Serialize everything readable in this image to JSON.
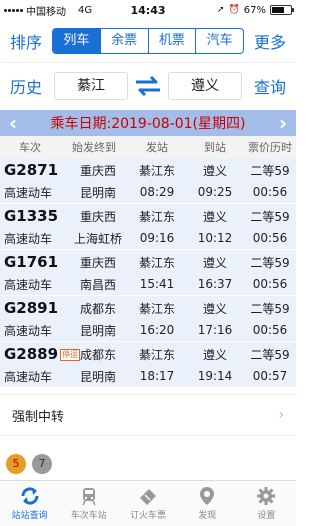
{
  "status": {
    "carrier": "中国移动",
    "network": "4G",
    "time": "14:43",
    "battery_pct": "67%",
    "battery_level": 0.67
  },
  "nav": {
    "left": "排序",
    "right": "更多",
    "segments": [
      {
        "label": "列车",
        "active": true
      },
      {
        "label": "余票",
        "active": false
      },
      {
        "label": "机票",
        "active": false
      },
      {
        "label": "汽车",
        "active": false
      }
    ]
  },
  "search": {
    "history": "历史",
    "from": "綦江",
    "to": "遵义",
    "query": "查询"
  },
  "date": {
    "text": "乘车日期:2019-08-01(星期四)"
  },
  "columns": [
    "车次",
    "始发终到",
    "发站",
    "到站",
    "票价历时"
  ],
  "trains": [
    {
      "no": "G2871",
      "type": "高速动车",
      "origin": "重庆西",
      "terminal": "昆明南",
      "dep_station": "綦江东",
      "dep_time": "08:29",
      "arr_station": "遵义",
      "arr_time": "09:25",
      "seat": "二等59",
      "duration": "00:56",
      "badge": ""
    },
    {
      "no": "G1335",
      "type": "高速动车",
      "origin": "重庆西",
      "terminal": "上海虹桥",
      "dep_station": "綦江东",
      "dep_time": "09:16",
      "arr_station": "遵义",
      "arr_time": "10:12",
      "seat": "二等59",
      "duration": "00:56",
      "badge": ""
    },
    {
      "no": "G1761",
      "type": "高速动车",
      "origin": "重庆西",
      "terminal": "南昌西",
      "dep_station": "綦江东",
      "dep_time": "15:41",
      "arr_station": "遵义",
      "arr_time": "16:37",
      "seat": "二等59",
      "duration": "00:56",
      "badge": ""
    },
    {
      "no": "G2891",
      "type": "高速动车",
      "origin": "成都东",
      "terminal": "昆明南",
      "dep_station": "綦江东",
      "dep_time": "16:20",
      "arr_station": "遵义",
      "arr_time": "17:16",
      "seat": "二等59",
      "duration": "00:56",
      "badge": ""
    },
    {
      "no": "G2889",
      "type": "高速动车",
      "origin": "成都东",
      "terminal": "昆明南",
      "dep_station": "綦江东",
      "dep_time": "18:17",
      "arr_station": "遵义",
      "arr_time": "19:14",
      "seat": "二等59",
      "duration": "00:57",
      "badge": "停运"
    }
  ],
  "transfer": {
    "label": "强制中转"
  },
  "floating": [
    "5",
    "7"
  ],
  "tabs": [
    {
      "label": "站站查询",
      "icon": "refresh-arrows-icon",
      "active": true
    },
    {
      "label": "车次车站",
      "icon": "train-icon",
      "active": false
    },
    {
      "label": "订火车票",
      "icon": "ticket-icon",
      "active": false
    },
    {
      "label": "发现",
      "icon": "location-pin-icon",
      "active": false
    },
    {
      "label": "设置",
      "icon": "gear-icon",
      "active": false
    }
  ],
  "colors": {
    "accent": "#1a6fd4",
    "date_bar": "#a3bde8",
    "row_bg": "#eaf1fb",
    "date_text": "#cc0000"
  }
}
